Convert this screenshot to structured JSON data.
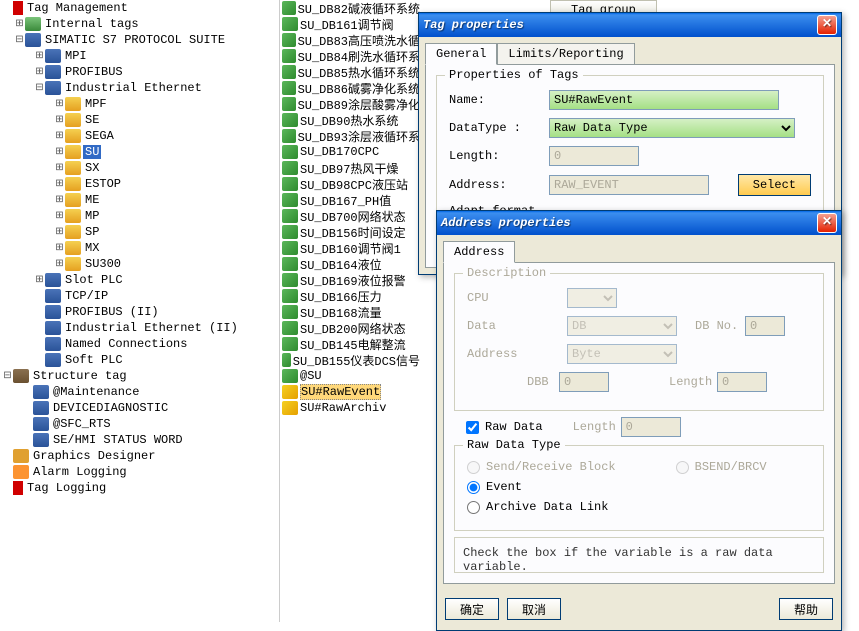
{
  "col_header": "Tag group",
  "tree": {
    "root": "Tag Management",
    "internal": "Internal tags",
    "s7": "SIMATIC S7 PROTOCOL SUITE",
    "mpi": "MPI",
    "profibus": "PROFIBUS",
    "ie": "Industrial Ethernet",
    "mpf": "MPF",
    "se": "SE",
    "sega": "SEGA",
    "su": "SU",
    "sx": "SX",
    "estop": "ESTOP",
    "me": "ME",
    "mp": "MP",
    "sp": "SP",
    "mx": "MX",
    "su300": "SU300",
    "slotplc": "Slot PLC",
    "tcpip": "TCP/IP",
    "profibus2": "PROFIBUS (II)",
    "ie2": "Industrial Ethernet (II)",
    "named": "Named Connections",
    "softplc": "Soft PLC",
    "struct": "Structure tag",
    "maint": "@Maintenance",
    "devdiag": "DEVICEDIAGNOSTIC",
    "sfc": "@SFC_RTS",
    "hmi": "SE/HMI STATUS WORD",
    "gfx": "Graphics Designer",
    "alarm": "Alarm Logging",
    "taglog": "Tag Logging"
  },
  "mid": [
    "SU_DB82碱液循环系统",
    "SU_DB161调节阀",
    "SU_DB83高压喷洗水循",
    "SU_DB84刷洗水循环系",
    "SU_DB85热水循环系统",
    "SU_DB86碱雾净化系统",
    "SU_DB89涂层酸雾净化",
    "SU_DB90热水系统",
    "SU_DB93涂层液循环系",
    "SU_DB170CPC",
    "SU_DB97热风干燥",
    "SU_DB98CPC液压站",
    "SU_DB167_PH值",
    "SU_DB700网络状态",
    "SU_DB156时间设定",
    "SU_DB160调节阀1",
    "SU_DB164液位",
    "SU_DB169液位报警",
    "SU_DB166压力",
    "SU_DB168流量",
    "SU_DB200网络状态",
    "SU_DB145电解整流",
    "SU_DB155仪表DCS信号",
    "@SU"
  ],
  "mid_sel": "SU#RawEvent",
  "mid_after": "SU#RawArchiv",
  "tag_dialog": {
    "title": "Tag properties",
    "tab_general": "General",
    "tab_limits": "Limits/Reporting",
    "group_title": "Properties of Tags",
    "name_label": "Name:",
    "name_value": "SU#RawEvent",
    "dtype_label": "DataType :",
    "dtype_value": "Raw Data Type",
    "length_label": "Length:",
    "length_value": "0",
    "address_label": "Address:",
    "address_value": "RAW_EVENT",
    "select_btn": "Select",
    "adapt_label": "Adapt format :"
  },
  "addr_dialog": {
    "title": "Address properties",
    "tab_address": "Address",
    "desc_title": "Description",
    "cpu": "CPU",
    "data": "Data",
    "data_val": "DB",
    "dbno": "DB No.",
    "dbno_val": "0",
    "address": "Address",
    "address_val": "Byte",
    "dbb": "DBB",
    "dbb_val": "0",
    "length": "Length",
    "length_val": "0",
    "raw_data": "Raw Data",
    "raw_len": "Length",
    "raw_len_val": "0",
    "rdt_title": "Raw Data Type",
    "rdt_send": "Send/Receive Block",
    "rdt_bsend": "BSEND/BRCV",
    "rdt_event": "Event",
    "rdt_archive": "Archive Data Link",
    "hint": "Check the box if the variable is a raw data variable.",
    "ok": "确定",
    "cancel": "取消",
    "help": "帮助"
  }
}
